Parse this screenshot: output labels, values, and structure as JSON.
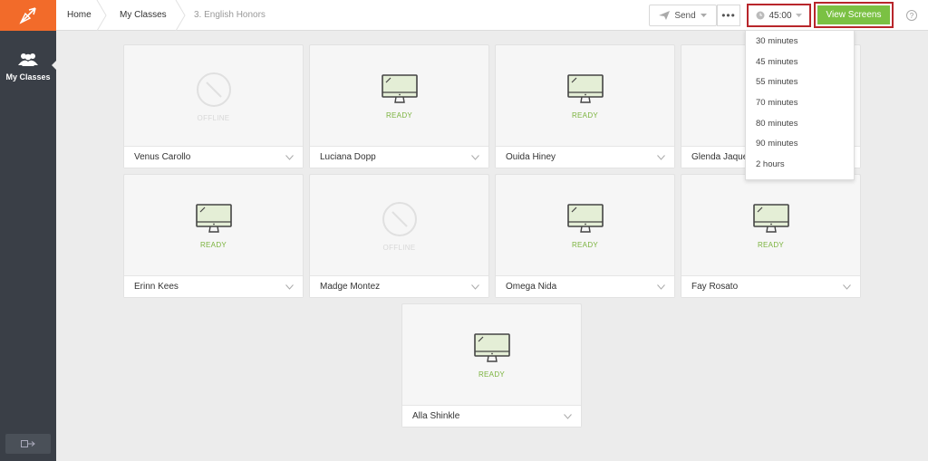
{
  "sidebar": {
    "nav_label": "My Classes"
  },
  "breadcrumb": [
    "Home",
    "My Classes",
    "3. English Honors"
  ],
  "toolbar": {
    "send_label": "Send",
    "more_label": "•••",
    "timer_value": "45:00",
    "view_screens_label": "View Screens",
    "help_label": "?"
  },
  "timer_options": [
    "30 minutes",
    "45 minutes",
    "55 minutes",
    "70 minutes",
    "80 minutes",
    "90 minutes",
    "2 hours"
  ],
  "students": [
    {
      "name": "Venus Carollo",
      "status": "OFFLINE"
    },
    {
      "name": "Luciana Dopp",
      "status": "READY"
    },
    {
      "name": "Ouida Hiney",
      "status": "READY"
    },
    {
      "name": "Glenda Jaque",
      "status": ""
    },
    {
      "name": "Erinn Kees",
      "status": "READY"
    },
    {
      "name": "Madge Montez",
      "status": "OFFLINE"
    },
    {
      "name": "Omega Nida",
      "status": "READY"
    },
    {
      "name": "Fay Rosato",
      "status": "READY"
    },
    {
      "name": "Alla Shinkle",
      "status": "READY"
    }
  ],
  "colors": {
    "accent": "#7bc143",
    "brand": "#f26b2a",
    "highlight": "#b8262b",
    "sidebar": "#3a3f47"
  }
}
